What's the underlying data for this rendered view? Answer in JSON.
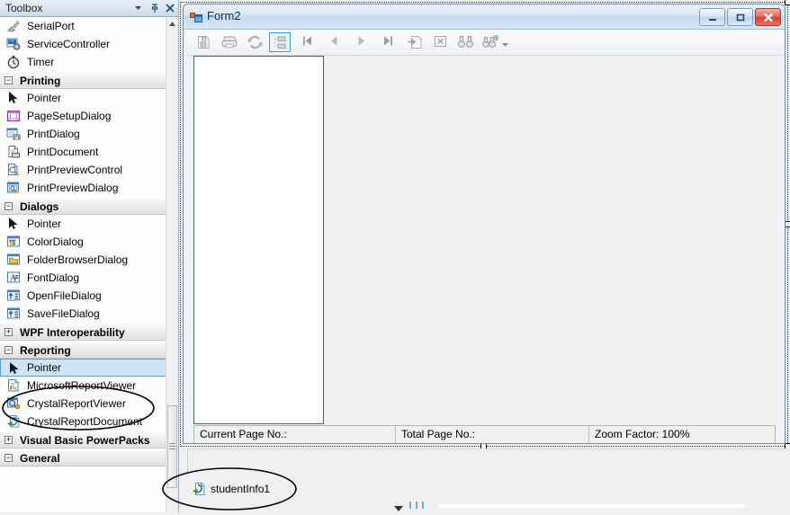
{
  "toolbox": {
    "title": "Toolbox",
    "header_buttons": [
      {
        "name": "dropdown",
        "label": "▾"
      },
      {
        "name": "auto-hide-pin",
        "label": "⚓"
      },
      {
        "name": "close",
        "label": "✕"
      }
    ],
    "nodes": [
      {
        "type": "item",
        "icon": "serialport-icon",
        "label": "SerialPort"
      },
      {
        "type": "item",
        "icon": "servicecontroller-icon",
        "label": "ServiceController"
      },
      {
        "type": "item",
        "icon": "timer-icon",
        "label": "Timer"
      },
      {
        "type": "group",
        "expander": "−",
        "label": "Printing"
      },
      {
        "type": "item",
        "icon": "pointer-icon",
        "label": "Pointer"
      },
      {
        "type": "item",
        "icon": "pagesetupdialog-icon",
        "label": "PageSetupDialog"
      },
      {
        "type": "item",
        "icon": "printdialog-icon",
        "label": "PrintDialog"
      },
      {
        "type": "item",
        "icon": "printdocument-icon",
        "label": "PrintDocument"
      },
      {
        "type": "item",
        "icon": "printpreviewcontrol-icon",
        "label": "PrintPreviewControl"
      },
      {
        "type": "item",
        "icon": "printpreviewdialog-icon",
        "label": "PrintPreviewDialog"
      },
      {
        "type": "group",
        "expander": "−",
        "label": "Dialogs"
      },
      {
        "type": "item",
        "icon": "pointer-icon",
        "label": "Pointer"
      },
      {
        "type": "item",
        "icon": "colordialog-icon",
        "label": "ColorDialog"
      },
      {
        "type": "item",
        "icon": "folderbrowserdialog-icon",
        "label": "FolderBrowserDialog"
      },
      {
        "type": "item",
        "icon": "fontdialog-icon",
        "label": "FontDialog"
      },
      {
        "type": "item",
        "icon": "openfiledialog-icon",
        "label": "OpenFileDialog"
      },
      {
        "type": "item",
        "icon": "savefiledialog-icon",
        "label": "SaveFileDialog"
      },
      {
        "type": "group",
        "expander": "+",
        "label": "WPF Interoperability"
      },
      {
        "type": "group",
        "expander": "−",
        "label": "Reporting"
      },
      {
        "type": "item",
        "icon": "pointer-icon",
        "label": "Pointer",
        "selected": true
      },
      {
        "type": "item",
        "icon": "microsoftreportviewer-icon",
        "label": "MicrosoftReportViewer"
      },
      {
        "type": "item",
        "icon": "crystalreportviewer-icon",
        "label": "CrystalReportViewer"
      },
      {
        "type": "item",
        "icon": "crystalreportdocument-icon",
        "label": "CrystalReportDocument"
      },
      {
        "type": "group",
        "expander": "+",
        "label": "Visual Basic PowerPacks"
      },
      {
        "type": "group",
        "expander": "−",
        "label": "General"
      }
    ]
  },
  "form": {
    "title": "Form2",
    "icon": "form-designer-icon",
    "window_buttons": [
      {
        "name": "minimize",
        "glyph": "minimize-icon"
      },
      {
        "name": "maximize",
        "glyph": "maximize-icon"
      },
      {
        "name": "close",
        "glyph": "close-icon"
      }
    ],
    "toolbar": [
      {
        "name": "export-report-button",
        "icon": "export-icon",
        "active": false
      },
      {
        "name": "print-report-button",
        "icon": "printer-icon",
        "active": false
      },
      {
        "name": "refresh-report-button",
        "icon": "refresh-icon",
        "active": false
      },
      {
        "name": "toggle-group-tree-button",
        "icon": "group-tree-icon",
        "active": true
      },
      {
        "name": "first-page-button",
        "icon": "first-page-icon",
        "active": false
      },
      {
        "name": "previous-page-button",
        "icon": "previous-page-icon",
        "active": false
      },
      {
        "name": "next-page-button",
        "icon": "next-page-icon",
        "active": false
      },
      {
        "name": "last-page-button",
        "icon": "last-page-icon",
        "active": false
      },
      {
        "name": "go-to-page-button",
        "icon": "go-to-page-icon",
        "active": false
      },
      {
        "name": "close-current-view-button",
        "icon": "close-view-icon",
        "active": false
      },
      {
        "name": "search-button",
        "icon": "binoculars-icon",
        "active": false
      },
      {
        "name": "search-add-button",
        "icon": "binoculars-plus-icon",
        "active": false
      }
    ],
    "status": {
      "current_page_label": "Current Page No.:",
      "total_page_label": "Total Page No.:",
      "zoom_label": "Zoom Factor: 100%"
    }
  },
  "component_tray": {
    "items": [
      {
        "name": "studentinfo1-component",
        "icon": "dataset-icon",
        "label": "studentInfo1"
      }
    ]
  },
  "annotations": [
    {
      "name": "annotation-ellipse-crystal-report-items",
      "shape": "ellipse"
    },
    {
      "name": "annotation-ellipse-studentinfo1",
      "shape": "ellipse"
    }
  ],
  "colors": {
    "selection_blue": "#cfe5f7",
    "selection_border": "#5b9bd5",
    "titlebar_blue": "#c5d9ef",
    "close_red": "#d4402f",
    "annotation_stroke": "#000000"
  }
}
